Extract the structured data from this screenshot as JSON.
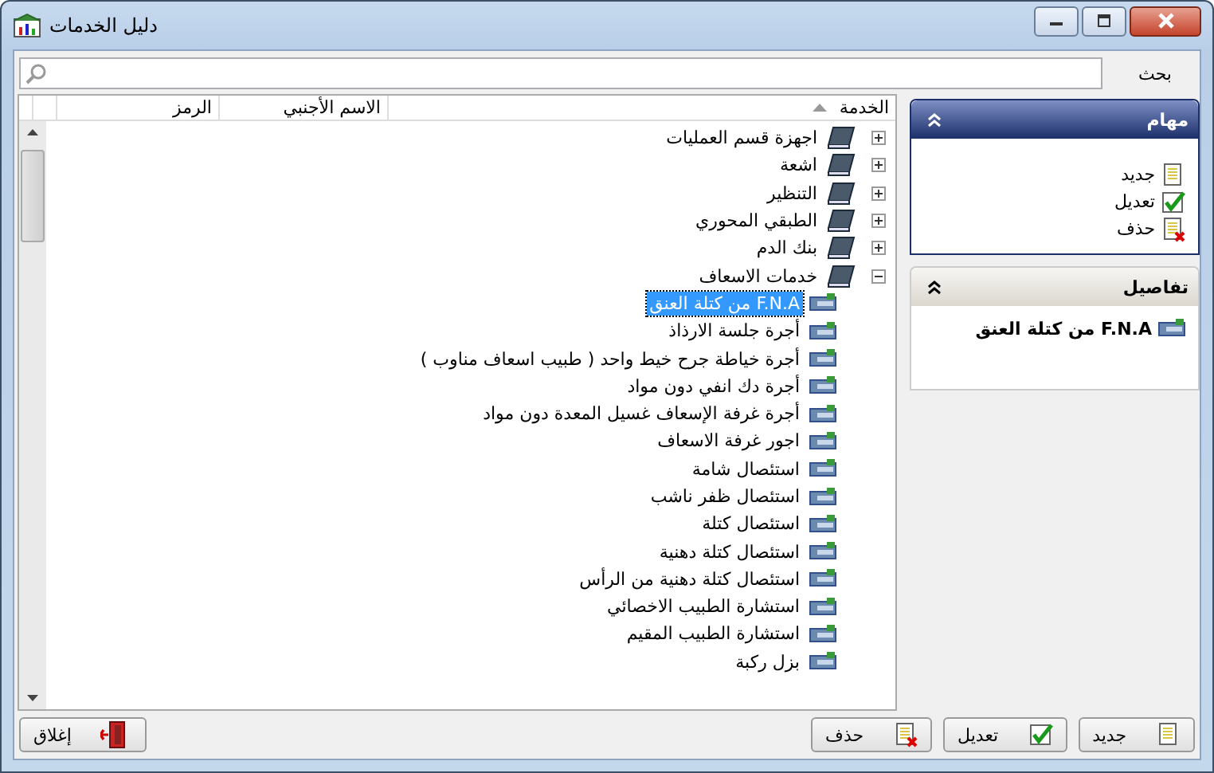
{
  "window": {
    "title": "دليل الخدمات"
  },
  "search": {
    "label": "بحث"
  },
  "columns": [
    "الخدمة",
    "الاسم الأجنبي",
    "الرمز"
  ],
  "tree": [
    {
      "label": "اجهزة قسم العمليات",
      "expanded": false
    },
    {
      "label": "اشعة",
      "expanded": false
    },
    {
      "label": "التنظير",
      "expanded": false
    },
    {
      "label": "الطبقي المحوري",
      "expanded": false
    },
    {
      "label": "بنك الدم",
      "expanded": false
    },
    {
      "label": "خدمات الاسعاف",
      "expanded": true,
      "children": [
        {
          "label": "F.N.A من كتلة العنق",
          "selected": true
        },
        {
          "label": "أجرة جلسة الارذاذ",
          "selected": false
        },
        {
          "label": "أجرة خياطة جرح خيط واحد ( طبيب اسعاف مناوب )",
          "selected": false
        },
        {
          "label": "أجرة دك انفي دون مواد",
          "selected": false
        },
        {
          "label": "أجرة غرفة  الإسعاف غسيل المعدة دون مواد",
          "selected": false
        },
        {
          "label": "اجور غرفة الاسعاف",
          "selected": false
        },
        {
          "label": "استئصال شامة",
          "selected": false
        },
        {
          "label": "استئصال ظفر ناشب",
          "selected": false
        },
        {
          "label": "استئصال كتلة",
          "selected": false
        },
        {
          "label": "استئصال كتلة دهنية",
          "selected": false
        },
        {
          "label": "استئصال كتلة دهنية من الرأس",
          "selected": false
        },
        {
          "label": "استشارة الطبيب الاخصائي",
          "selected": false
        },
        {
          "label": "استشارة الطبيب المقيم",
          "selected": false
        },
        {
          "label": "بزل ركبة",
          "selected": false
        }
      ]
    }
  ],
  "tasks": {
    "title": "مهام",
    "items": [
      {
        "kind": "new",
        "label": "جديد"
      },
      {
        "kind": "edit",
        "label": "تعديل"
      },
      {
        "kind": "delete",
        "label": "حذف"
      }
    ]
  },
  "details": {
    "title": "تفاصيل",
    "item": "F.N.A من كتلة العنق"
  },
  "buttons": [
    {
      "kind": "new",
      "label": "جديد"
    },
    {
      "kind": "edit",
      "label": "تعديل"
    },
    {
      "kind": "delete",
      "label": "حذف"
    }
  ],
  "close_button": {
    "label": "إغلاق"
  }
}
